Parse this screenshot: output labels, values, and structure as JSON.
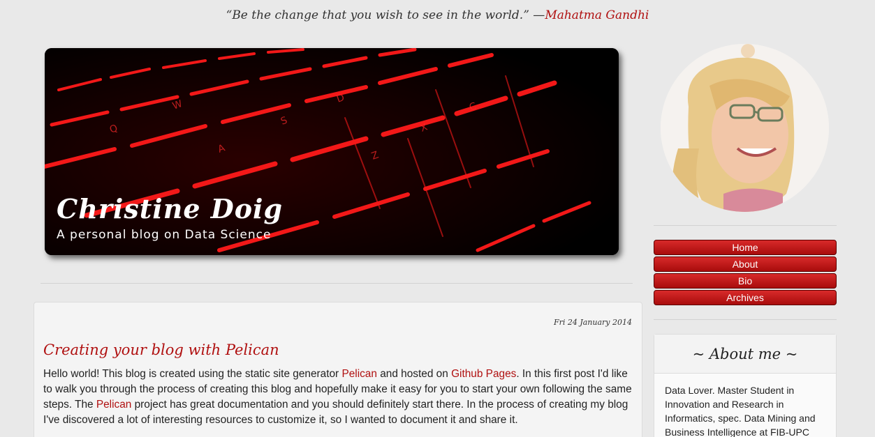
{
  "quote": {
    "text": "“Be the change that you wish to see in the world.” —",
    "author": "Mahatma Gandhi"
  },
  "header": {
    "site_title": "Christine Doig",
    "tagline": "A personal blog on Data Science",
    "banner_icon": "keyboard-image"
  },
  "post": {
    "date": "Fri 24 January 2014",
    "title": "Creating your blog with Pelican",
    "intro_1": "Hello world! This blog is created using the static site generator ",
    "link_pelican": "Pelican",
    "intro_2": " and hosted on ",
    "link_github": "Github Pages",
    "intro_3": ". In this first post I'd like to walk you through the process of creating this blog and hopefully make it easy for you to start your own following the same steps. The ",
    "link_pelican_2": "Pelican",
    "intro_4": " project has great documentation and you should definitely start there. In the process of creating my blog I've discovered a lot of interesting resources to customize it, so I wanted to document it and share it."
  },
  "sidebar": {
    "avatar_icon": "profile-photo",
    "nav": [
      {
        "label": "Home"
      },
      {
        "label": "About"
      },
      {
        "label": "Bio"
      },
      {
        "label": "Archives"
      }
    ],
    "about": {
      "heading": "~ About me ~",
      "text": "Data Lover. Master Student in Innovation and Research in Informatics, spec. Data Mining and Business Intelligence at FIB-UPC"
    }
  },
  "colors": {
    "accent": "#b01010",
    "background": "#e9e9e9",
    "button": "#c01818"
  }
}
